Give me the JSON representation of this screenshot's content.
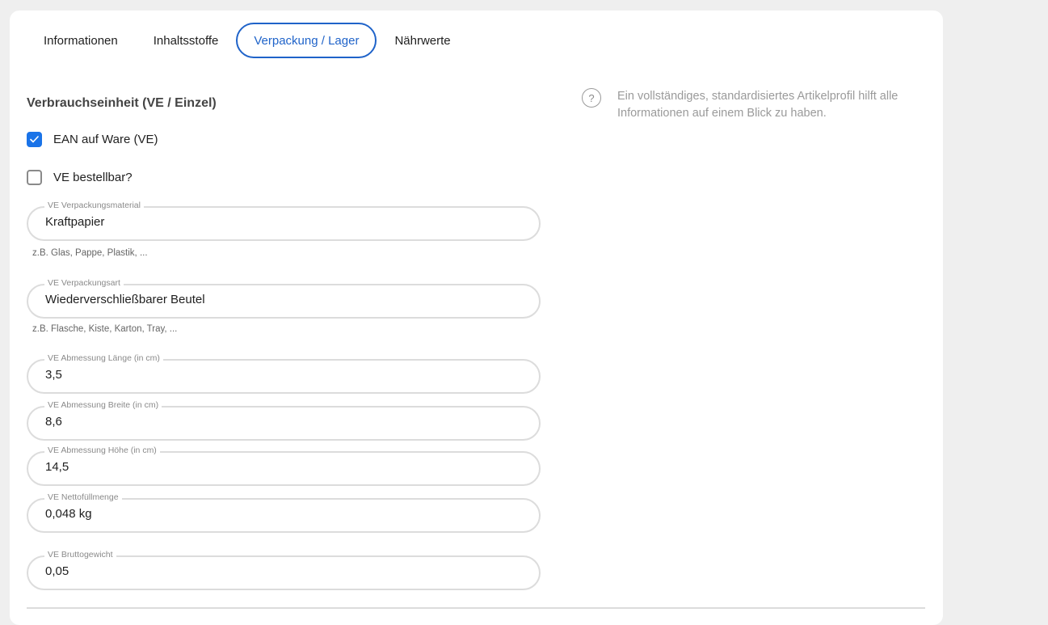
{
  "tabs": [
    {
      "label": "Informationen"
    },
    {
      "label": "Inhaltsstoffe"
    },
    {
      "label": "Verpackung / Lager"
    },
    {
      "label": "Nährwerte"
    }
  ],
  "active_tab": "Verpackung / Lager",
  "section": {
    "title": "Verbrauchseinheit (VE / Einzel)"
  },
  "checkboxes": {
    "ean": {
      "label": "EAN auf Ware (VE)",
      "checked": true
    },
    "bestellbar": {
      "label": "VE bestellbar?",
      "checked": false
    }
  },
  "fields": {
    "material": {
      "label": "VE Verpackungsmaterial",
      "value": "Kraftpapier",
      "hint": "z.B. Glas, Pappe, Plastik, ..."
    },
    "art": {
      "label": "VE Verpackungsart",
      "value": "Wiederverschließbarer Beutel",
      "hint": "z.B. Flasche, Kiste, Karton, Tray, ..."
    },
    "laenge": {
      "label": "VE Abmessung Länge (in cm)",
      "value": "3,5"
    },
    "breite": {
      "label": "VE Abmessung Breite (in cm)",
      "value": "8,6"
    },
    "hoehe": {
      "label": "VE Abmessung Höhe (in cm)",
      "value": "14,5"
    },
    "netto": {
      "label": "VE Nettofüllmenge",
      "value": "0,048 kg"
    },
    "brutto": {
      "label": "VE Bruttogewicht",
      "value": "0,05"
    }
  },
  "help": {
    "icon": "question-circle-icon",
    "text": "Ein vollständiges, standardisiertes Artikelprofil hilft alle Informationen auf einem Blick zu haben."
  },
  "colors": {
    "accent": "#1a73e8",
    "active_tab": "#1f63c9",
    "background": "#efefef"
  }
}
